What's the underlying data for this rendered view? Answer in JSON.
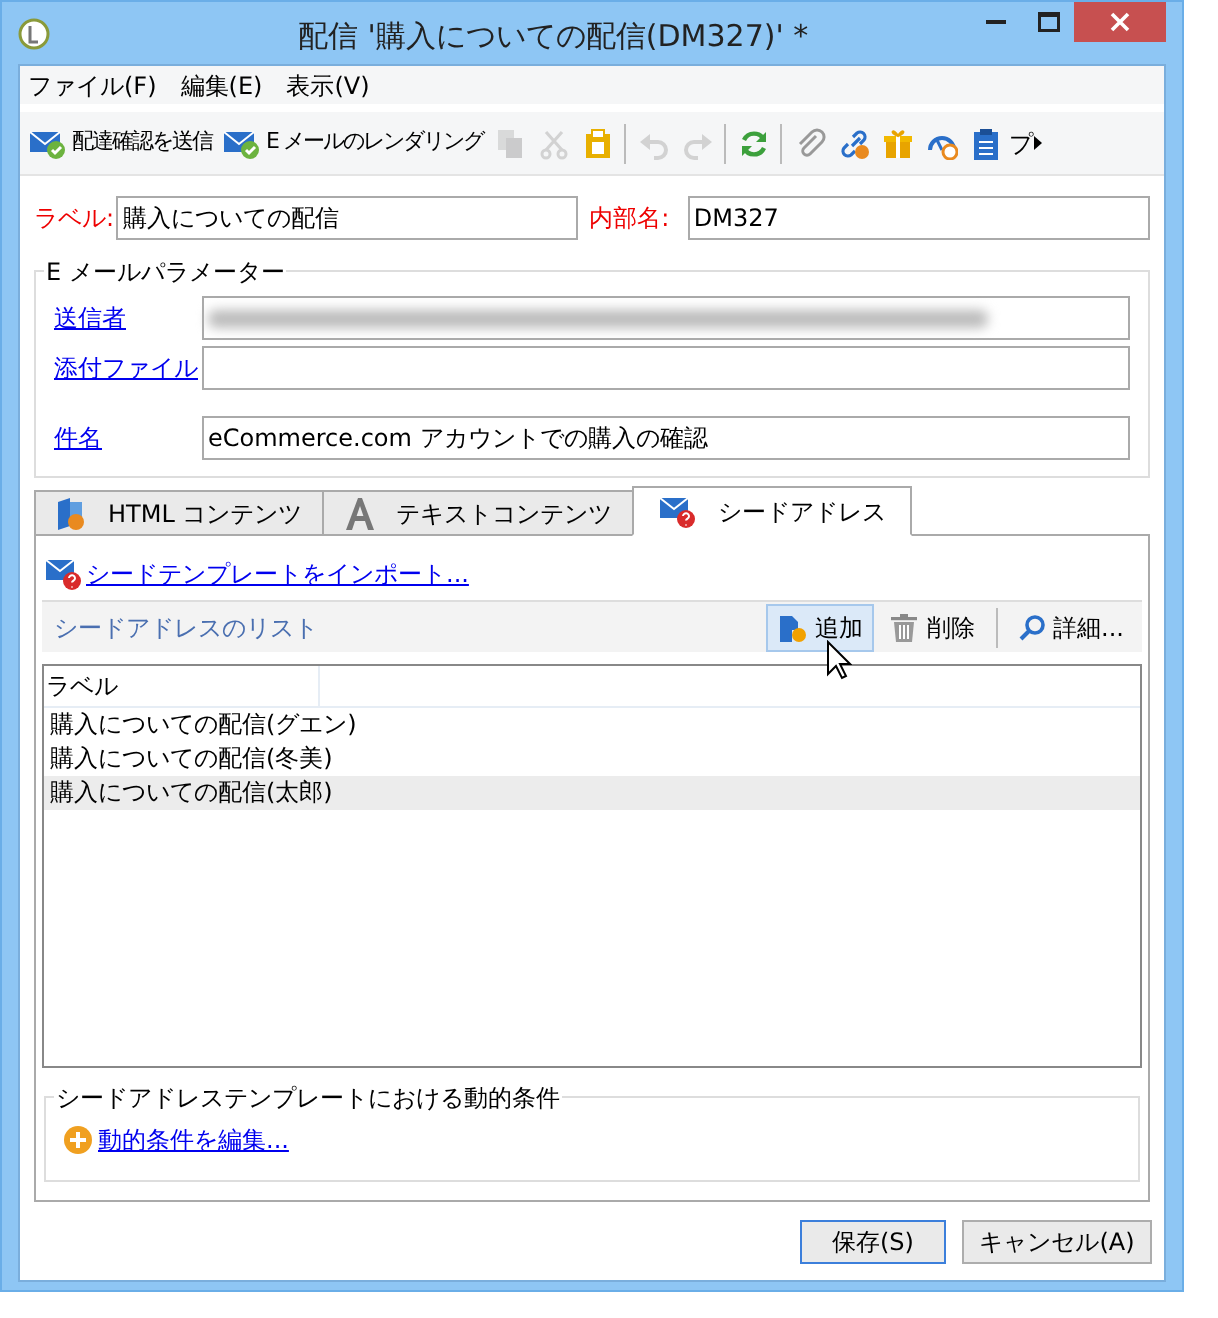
{
  "window": {
    "title": "配信 '購入についての配信(DM327)' *"
  },
  "menu": [
    "ファイル(F)",
    "編集(E)",
    "表示(V)"
  ],
  "toolbar": [
    {
      "kind": "button",
      "label": "配達確認を送信",
      "disabled": false
    },
    {
      "kind": "button",
      "label": "E メールのレンダリング",
      "disabled": false
    },
    {
      "kind": "icon",
      "disabled": true
    },
    {
      "kind": "icon",
      "disabled": true
    },
    {
      "kind": "icon",
      "disabled": false
    },
    {
      "kind": "separator"
    },
    {
      "kind": "icon",
      "disabled": true
    },
    {
      "kind": "icon",
      "disabled": true
    },
    {
      "kind": "separator"
    },
    {
      "kind": "icon",
      "disabled": false
    },
    {
      "kind": "separator"
    },
    {
      "kind": "icon",
      "disabled": false
    },
    {
      "kind": "icon",
      "disabled": false
    },
    {
      "kind": "icon",
      "disabled": false
    },
    {
      "kind": "icon",
      "disabled": false
    },
    {
      "kind": "icon",
      "disabled": false
    },
    {
      "kind": "overflow",
      "label": "プ"
    }
  ],
  "label_field": {
    "label": "ラベル:",
    "value": "購入についての配信"
  },
  "internal_name": {
    "label": "内部名:",
    "value": "DM327"
  },
  "email_params": {
    "title": "E メールパラメーター",
    "fields": [
      {
        "label": "送信者",
        "redacted": true
      },
      {
        "label": "添付ファイル",
        "redacted": false
      },
      {
        "label": "件名",
        "value": "eCommerce.com アカウントでの購入の確認",
        "redacted": false
      }
    ]
  },
  "tabs": [
    {
      "label": "HTML コンテンツ",
      "selected": false
    },
    {
      "label": "テキストコンテンツ",
      "selected": false
    },
    {
      "label": "シードアドレス",
      "selected": true
    }
  ],
  "import_link": "シードテンプレートをインポート...",
  "list": {
    "title": "シードアドレスのリスト",
    "actions": [
      {
        "label": "追加",
        "highlighted": true
      },
      {
        "label": "削除",
        "highlighted": false
      },
      {
        "label": "詳細...",
        "highlighted": false
      }
    ],
    "column": "ラベル",
    "rows": [
      {
        "label": "購入についての配信(グエン)",
        "selected": false
      },
      {
        "label": "購入についての配信(冬美)",
        "selected": false
      },
      {
        "label": "購入についての配信(太郎)",
        "selected": true
      }
    ]
  },
  "dynamic": {
    "title": "シードアドレステンプレートにおける動的条件",
    "link": "動的条件を編集..."
  },
  "buttons": [
    {
      "label": "保存(S)",
      "default": true
    },
    {
      "label": "キャンセル(A)",
      "default": false
    }
  ]
}
